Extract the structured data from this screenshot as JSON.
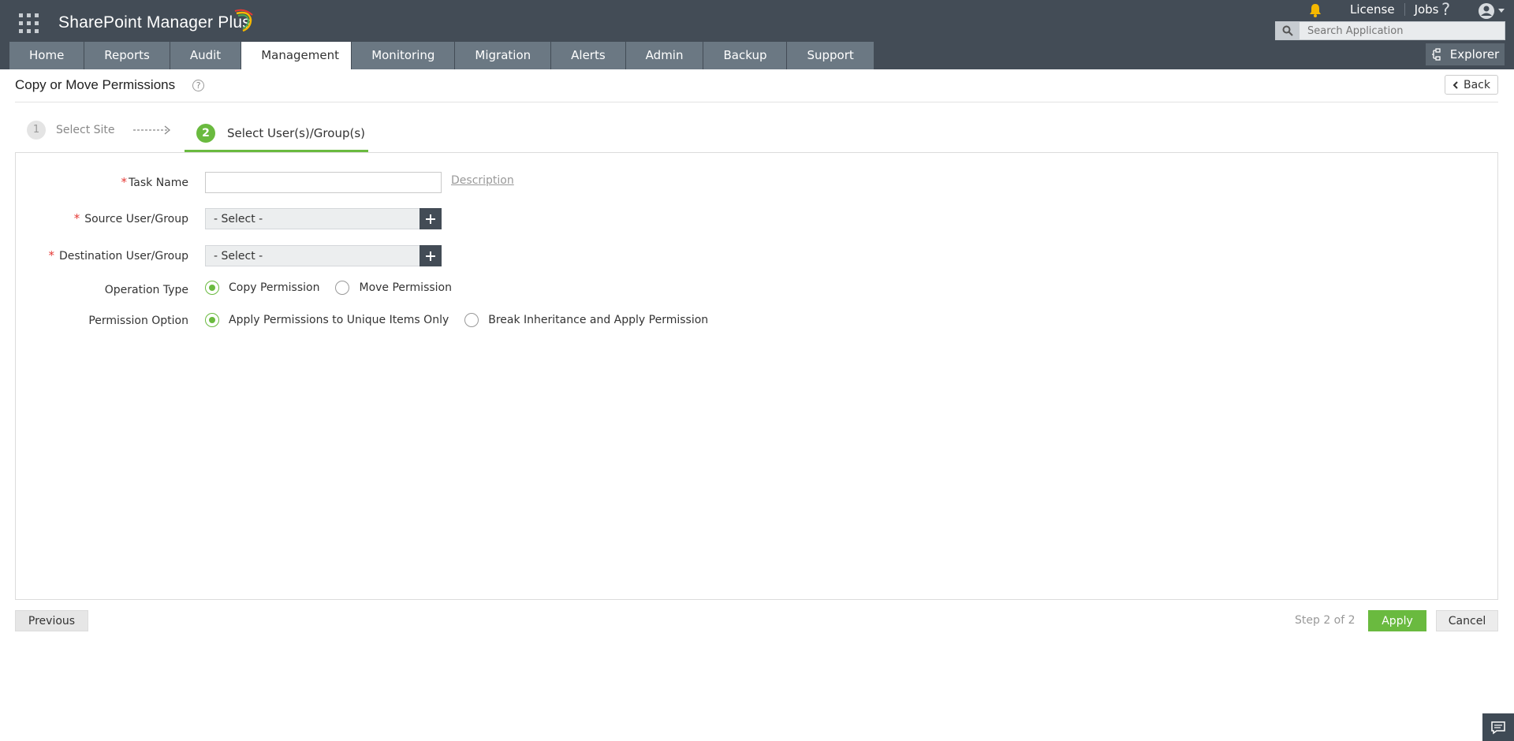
{
  "app": {
    "brand": "SharePoint Manager Plus"
  },
  "topbar": {
    "links": [
      "License",
      "Jobs"
    ],
    "help_label": "?",
    "search_placeholder": "Search Application",
    "explorer_label": "Explorer"
  },
  "nav": {
    "tabs": [
      {
        "label": "Home",
        "active": false
      },
      {
        "label": "Reports",
        "active": false
      },
      {
        "label": "Audit",
        "active": false
      },
      {
        "label": "Management",
        "active": true
      },
      {
        "label": "Monitoring",
        "active": false
      },
      {
        "label": "Migration",
        "active": false
      },
      {
        "label": "Alerts",
        "active": false
      },
      {
        "label": "Admin",
        "active": false
      },
      {
        "label": "Backup",
        "active": false
      },
      {
        "label": "Support",
        "active": false
      }
    ]
  },
  "page": {
    "title": "Copy or Move Permissions",
    "back_label": "Back",
    "help_icon": "?"
  },
  "steps": [
    {
      "num": "1",
      "label": "Select Site"
    },
    {
      "num": "2",
      "label": "Select User(s)/Group(s)"
    }
  ],
  "form": {
    "task_name_label": "Task Name",
    "task_name_value": "",
    "description_link": "Description",
    "source_label": "Source User/Group",
    "source_value": "- Select -",
    "destination_label": "Destination User/Group",
    "destination_value": "- Select -",
    "operation_label": "Operation Type",
    "operation_options": [
      "Copy Permission",
      "Move Permission"
    ],
    "operation_selected": "Copy Permission",
    "permission_label": "Permission Option",
    "permission_options": [
      "Apply Permissions to Unique Items Only",
      "Break Inheritance and Apply Permission"
    ],
    "permission_selected": "Apply Permissions to Unique Items Only",
    "required_mark": "*"
  },
  "footer": {
    "previous_label": "Previous",
    "step_info": "Step 2 of 2",
    "apply_label": "Apply",
    "cancel_label": "Cancel"
  },
  "colors": {
    "header": "#434c56",
    "nav": "#6b7883",
    "accent": "#6aba3f",
    "required": "#e53935"
  },
  "icons": [
    "apps-grid-icon",
    "bell-icon",
    "help-icon",
    "user-avatar-icon",
    "search-icon",
    "explorer-icon",
    "back-chevron-icon",
    "plus-icon",
    "chat-icon"
  ]
}
